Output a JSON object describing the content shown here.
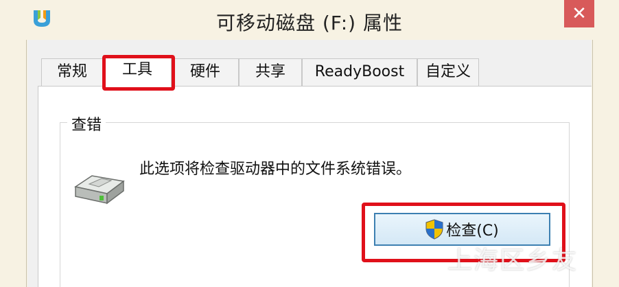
{
  "window": {
    "title": "可移动磁盘 (F:) 属性",
    "close_glyph": "✕"
  },
  "tabs": [
    {
      "label": "常规",
      "active": false
    },
    {
      "label": "工具",
      "active": true
    },
    {
      "label": "硬件",
      "active": false
    },
    {
      "label": "共享",
      "active": false
    },
    {
      "label": "ReadyBoost",
      "active": false
    },
    {
      "label": "自定义",
      "active": false
    }
  ],
  "error_check": {
    "group_title": "查错",
    "description": "此选项将检查驱动器中的文件系统错误。",
    "button_label": "检查(C)",
    "icons": {
      "drive": "removable-drive-icon",
      "shield": "uac-shield-icon"
    }
  },
  "watermark": "上海区乡友",
  "colors": {
    "highlight": "#e0101a",
    "close_button": "#d85a5a",
    "button_border": "#3c7fb1",
    "title_bar": "#f7f2e3"
  }
}
